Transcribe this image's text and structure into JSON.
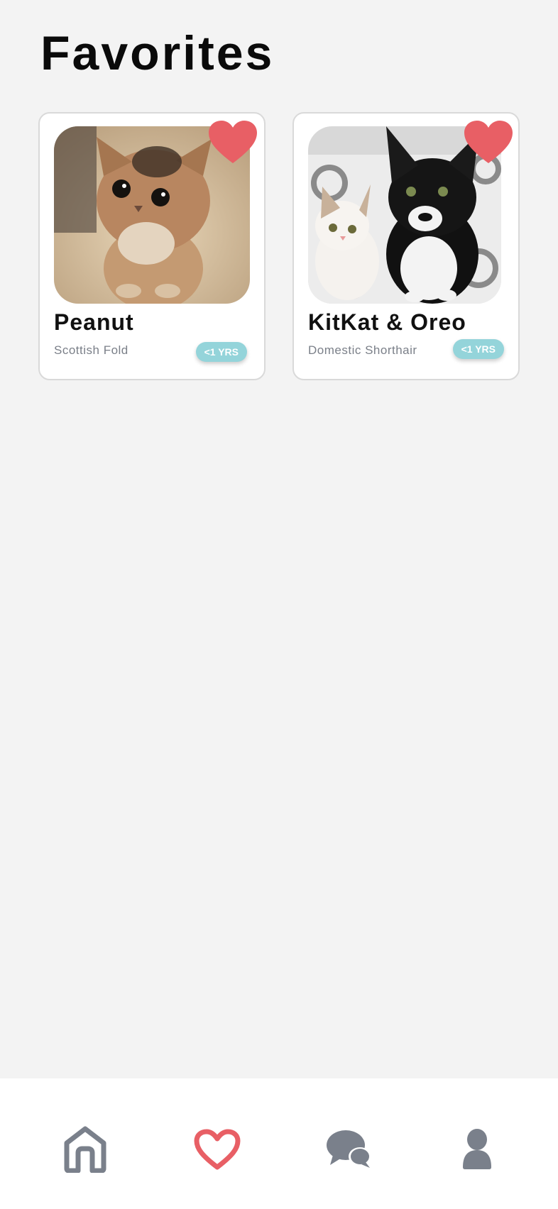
{
  "page": {
    "title": "Favorites"
  },
  "colors": {
    "accent_heart": "#e85f65",
    "badge": "#94d4da",
    "nav_inactive": "#7a808b",
    "background": "#f3f3f3"
  },
  "favorites": [
    {
      "name": "Peanut",
      "breed": "Scottish Fold",
      "age": "<1 YRS",
      "photo_icon": "kitten-photo"
    },
    {
      "name": "KitKat & Oreo",
      "breed": "Domestic Shorthair",
      "age": "<1 YRS",
      "photo_icon": "kittens-photo"
    }
  ],
  "nav": {
    "items": [
      {
        "icon": "home-icon",
        "active": false
      },
      {
        "icon": "heart-icon",
        "active": true
      },
      {
        "icon": "chat-icon",
        "active": false
      },
      {
        "icon": "profile-icon",
        "active": false
      }
    ]
  }
}
